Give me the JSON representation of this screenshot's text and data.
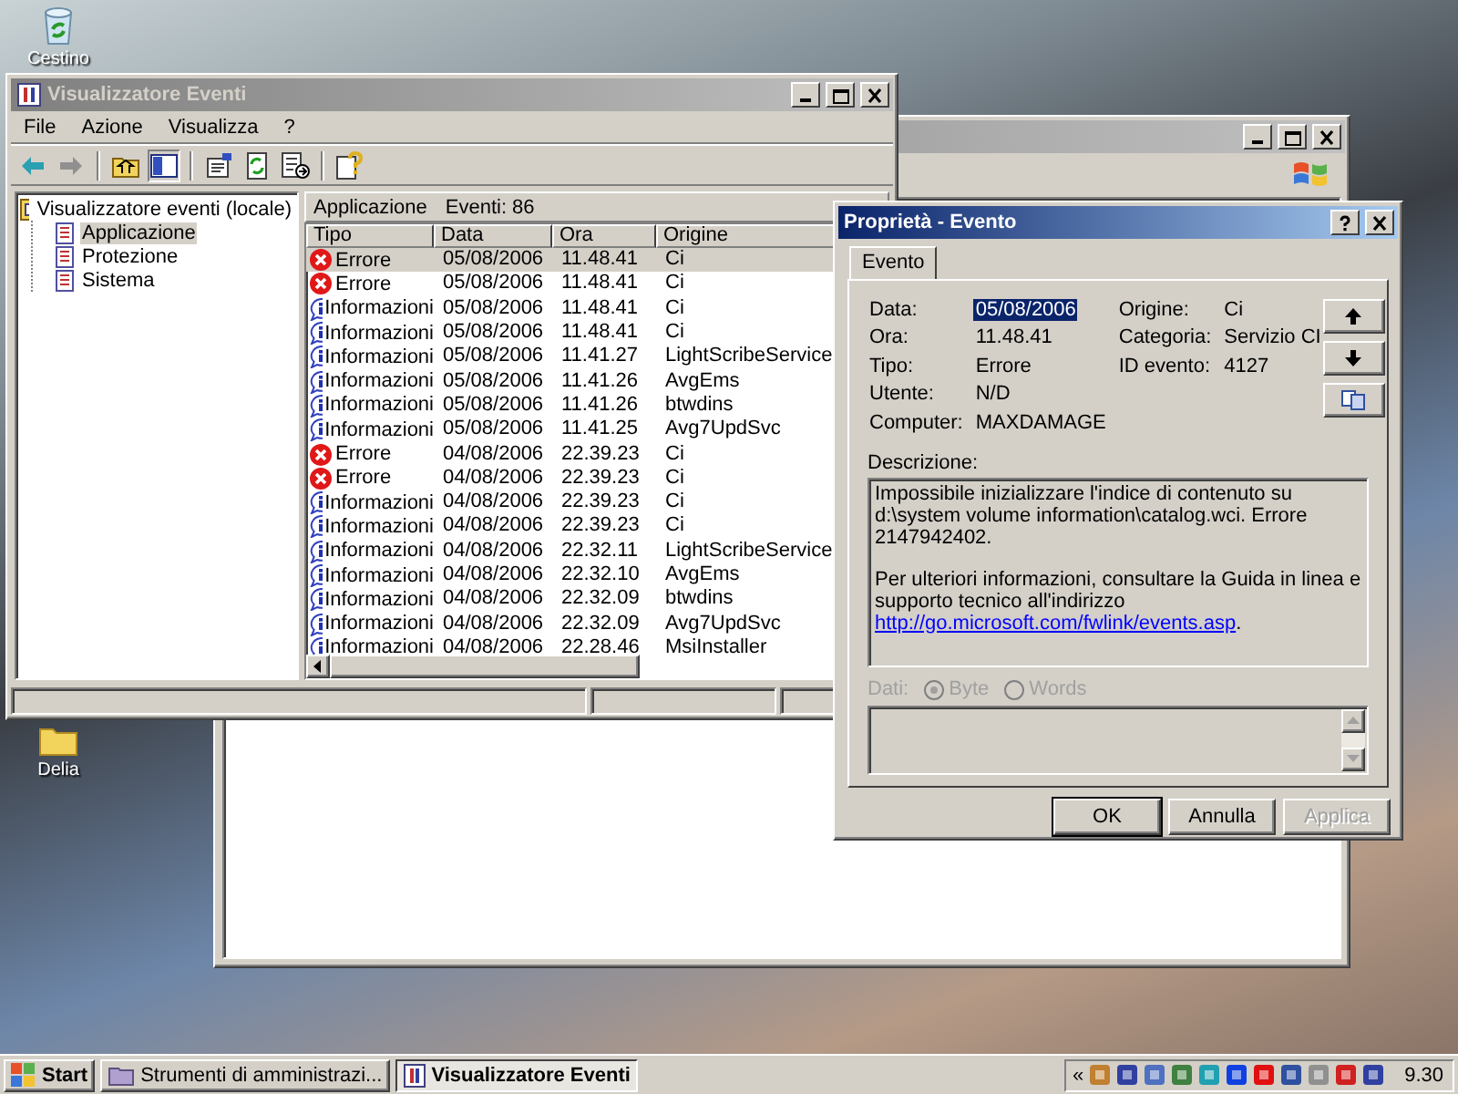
{
  "desktop": {
    "icons": [
      {
        "label": "Cestino",
        "kind": "recycle-bin"
      },
      {
        "label": "Delia",
        "kind": "folder"
      }
    ]
  },
  "event_viewer": {
    "title": "Visualizzatore Eventi",
    "active": false,
    "menu": [
      "File",
      "Azione",
      "Visualizza",
      "?"
    ],
    "tree": {
      "label": "Visualizzatore eventi (locale)",
      "children": [
        {
          "label": "Applicazione",
          "selected": true
        },
        {
          "label": "Protezione",
          "selected": false
        },
        {
          "label": "Sistema",
          "selected": false
        }
      ]
    },
    "list_title": "Applicazione",
    "event_count": "Eventi: 86",
    "columns": [
      "Tipo",
      "Data",
      "Ora",
      "Origine"
    ],
    "rows": [
      {
        "kind": "error",
        "type": "Errore",
        "date": "05/08/2006",
        "time": "11.48.41",
        "source": "Ci",
        "selected": true
      },
      {
        "kind": "error",
        "type": "Errore",
        "date": "05/08/2006",
        "time": "11.48.41",
        "source": "Ci",
        "selected": false
      },
      {
        "kind": "info",
        "type": "Informazioni",
        "date": "05/08/2006",
        "time": "11.48.41",
        "source": "Ci",
        "selected": false
      },
      {
        "kind": "info",
        "type": "Informazioni",
        "date": "05/08/2006",
        "time": "11.48.41",
        "source": "Ci",
        "selected": false
      },
      {
        "kind": "info",
        "type": "Informazioni",
        "date": "05/08/2006",
        "time": "11.41.27",
        "source": "LightScribeService",
        "selected": false
      },
      {
        "kind": "info",
        "type": "Informazioni",
        "date": "05/08/2006",
        "time": "11.41.26",
        "source": "AvgEms",
        "selected": false
      },
      {
        "kind": "info",
        "type": "Informazioni",
        "date": "05/08/2006",
        "time": "11.41.26",
        "source": "btwdins",
        "selected": false
      },
      {
        "kind": "info",
        "type": "Informazioni",
        "date": "05/08/2006",
        "time": "11.41.25",
        "source": "Avg7UpdSvc",
        "selected": false
      },
      {
        "kind": "error",
        "type": "Errore",
        "date": "04/08/2006",
        "time": "22.39.23",
        "source": "Ci",
        "selected": false
      },
      {
        "kind": "error",
        "type": "Errore",
        "date": "04/08/2006",
        "time": "22.39.23",
        "source": "Ci",
        "selected": false
      },
      {
        "kind": "info",
        "type": "Informazioni",
        "date": "04/08/2006",
        "time": "22.39.23",
        "source": "Ci",
        "selected": false
      },
      {
        "kind": "info",
        "type": "Informazioni",
        "date": "04/08/2006",
        "time": "22.39.23",
        "source": "Ci",
        "selected": false
      },
      {
        "kind": "info",
        "type": "Informazioni",
        "date": "04/08/2006",
        "time": "22.32.11",
        "source": "LightScribeService",
        "selected": false
      },
      {
        "kind": "info",
        "type": "Informazioni",
        "date": "04/08/2006",
        "time": "22.32.10",
        "source": "AvgEms",
        "selected": false
      },
      {
        "kind": "info",
        "type": "Informazioni",
        "date": "04/08/2006",
        "time": "22.32.09",
        "source": "btwdins",
        "selected": false
      },
      {
        "kind": "info",
        "type": "Informazioni",
        "date": "04/08/2006",
        "time": "22.32.09",
        "source": "Avg7UpdSvc",
        "selected": false
      },
      {
        "kind": "info",
        "type": "Informazioni",
        "date": "04/08/2006",
        "time": "22.28.46",
        "source": "MsiInstaller",
        "selected": false
      }
    ]
  },
  "properties_dialog": {
    "title": "Proprietà - Evento",
    "active": true,
    "tabs": [
      {
        "label": "Evento",
        "selected": true
      }
    ],
    "left_fields": [
      {
        "label": "Data:",
        "value": "05/08/2006",
        "selected": true
      },
      {
        "label": "Ora:",
        "value": "11.48.41",
        "selected": false
      },
      {
        "label": "Tipo:",
        "value": "Errore",
        "selected": false
      },
      {
        "label": "Utente:",
        "value": "N/D",
        "selected": false
      },
      {
        "label": "Computer:",
        "value": "MAXDAMAGE",
        "selected": false
      }
    ],
    "right_fields": [
      {
        "label": "Origine:",
        "value": "Ci",
        "selected": false
      },
      {
        "label": "Categoria:",
        "value": "Servizio CI",
        "selected": false
      },
      {
        "label": "ID evento:",
        "value": "4127",
        "selected": false
      }
    ],
    "description_label": "Descrizione:",
    "description": [
      {
        "text": "Impossibile inizializzare l'indice di contenuto su d:\\system volume information\\catalog.wci. Errore 2147942402."
      },
      {
        "text": "Per ulteriori informazioni, consultare la Guida in linea e supporto tecnico all'indirizzo ",
        "link": "http://go.microsoft.com/fwlink/events.asp",
        "after": "."
      }
    ],
    "data_label": "Dati:",
    "data_disabled": true,
    "data_options": [
      {
        "label": "Byte",
        "selected": true
      },
      {
        "label": "Words",
        "selected": false
      }
    ],
    "buttons": [
      {
        "label": "OK",
        "disabled": false
      },
      {
        "label": "Annulla",
        "disabled": false
      },
      {
        "label": "Applica",
        "disabled": true
      }
    ]
  },
  "taskbar": {
    "start": "Start",
    "tasks": [
      {
        "label": "Strumenti di amministrazi...",
        "selected": false
      },
      {
        "label": "Visualizzatore Eventi",
        "selected": true
      }
    ],
    "tray_chevron": "«",
    "clock": "9.30"
  }
}
